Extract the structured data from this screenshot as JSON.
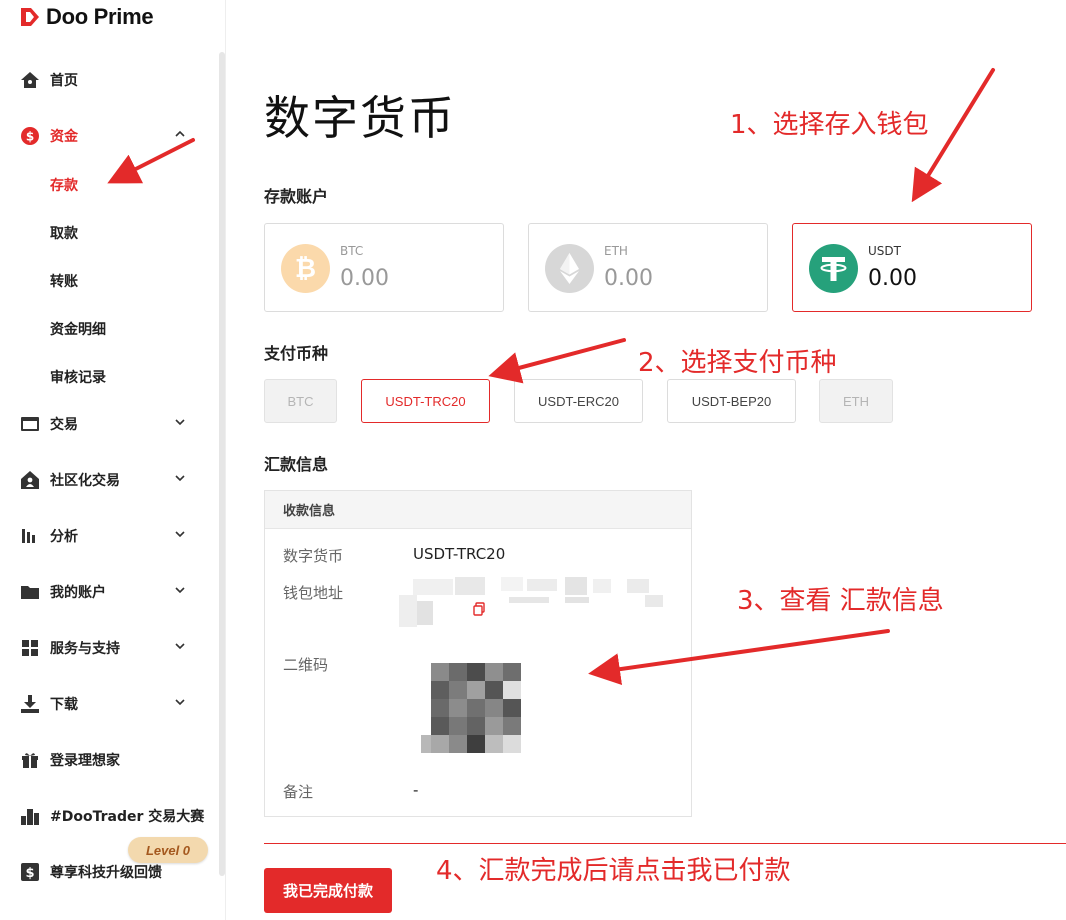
{
  "brand": {
    "name": "Doo Prime"
  },
  "colors": {
    "accent": "#e32a2a",
    "usdt": "#26a17b",
    "btc": "#f7931a",
    "level_badge": "#f3d9ae"
  },
  "sidebar": {
    "items": [
      {
        "label": "首页",
        "icon": "home-icon"
      },
      {
        "label": "资金",
        "icon": "dollar-circle-icon",
        "expanded": true
      },
      {
        "label": "交易",
        "icon": "card-icon"
      },
      {
        "label": "社区化交易",
        "icon": "people-house-icon"
      },
      {
        "label": "分析",
        "icon": "bar-chart-icon"
      },
      {
        "label": "我的账户",
        "icon": "folder-icon"
      },
      {
        "label": "服务与支持",
        "icon": "grid-icon"
      },
      {
        "label": "下载",
        "icon": "download-icon"
      },
      {
        "label": "登录理想家",
        "icon": "gift-icon"
      },
      {
        "label": "#DooTrader 交易大赛",
        "icon": "podium-icon"
      },
      {
        "label": "尊享科技升级回馈",
        "icon": "dollar-square-icon"
      }
    ],
    "sub_items": [
      "存款",
      "取款",
      "转账",
      "资金明细",
      "审核记录"
    ],
    "level_badge": "Level 0"
  },
  "main": {
    "title": "数字货币",
    "deposit_account_label": "存款账户",
    "wallets": [
      {
        "name": "BTC",
        "amount": "0.00"
      },
      {
        "name": "ETH",
        "amount": "0.00"
      },
      {
        "name": "USDT",
        "amount": "0.00",
        "selected": true
      }
    ],
    "payment_currency_label": "支付币种",
    "payment_options": [
      {
        "label": "BTC",
        "state": "disabled"
      },
      {
        "label": "USDT-TRC20",
        "state": "selected"
      },
      {
        "label": "USDT-ERC20",
        "state": "normal"
      },
      {
        "label": "USDT-BEP20",
        "state": "normal"
      },
      {
        "label": "ETH",
        "state": "disabled"
      }
    ],
    "remittance_label": "汇款信息",
    "receipt": {
      "header": "收款信息",
      "rows": [
        {
          "key": "数字货币",
          "value": "USDT-TRC20"
        },
        {
          "key": "钱包地址",
          "value": ""
        },
        {
          "key": "二维码",
          "value": ""
        },
        {
          "key": "备注",
          "value": "-"
        }
      ]
    },
    "submit_label": "我已完成付款"
  },
  "annotations": {
    "step1": "1、选择存入钱包",
    "step2": "2、选择支付币种",
    "step3": "3、查看 汇款信息",
    "step4": "4、汇款完成后请点击我已付款"
  }
}
